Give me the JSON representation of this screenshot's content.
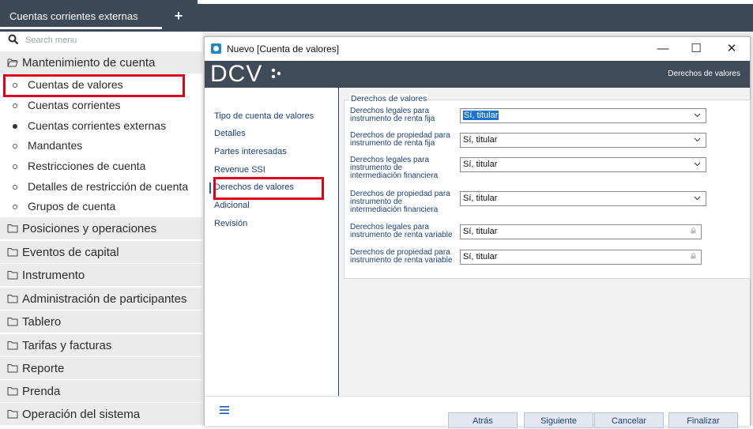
{
  "topbar": {
    "tab_label": "Cuentas corrientes externas",
    "add_icon": "plus-icon"
  },
  "sidebar": {
    "search_placeholder": "Search menu",
    "groups": [
      {
        "label": "Mantenimiento de cuenta",
        "expanded": true
      },
      {
        "label": "Posiciones y operaciones"
      },
      {
        "label": "Eventos de capital"
      },
      {
        "label": "Instrumento"
      },
      {
        "label": "Administración de participantes"
      },
      {
        "label": "Tablero"
      },
      {
        "label": "Tarifas y facturas"
      },
      {
        "label": "Reporte"
      },
      {
        "label": "Prenda"
      },
      {
        "label": "Operación del sistema"
      }
    ],
    "subitems": [
      {
        "label": "Cuentas de valores"
      },
      {
        "label": "Cuentas corrientes"
      },
      {
        "label": "Cuentas corrientes externas",
        "current": true
      },
      {
        "label": "Mandantes"
      },
      {
        "label": "Restricciones de cuenta"
      },
      {
        "label": "Detalles de restricción de cuenta"
      },
      {
        "label": "Grupos de cuenta"
      }
    ]
  },
  "dialog": {
    "title": "Nuevo [Cuenta de valores]",
    "logo": "DCV",
    "section_title": "Derechos de valores",
    "window_controls": {
      "minimize": "—",
      "maximize": "☐",
      "close": "✕"
    },
    "steps": [
      {
        "label": "Tipo de cuenta de valores"
      },
      {
        "label": "Detalles"
      },
      {
        "label": "Partes interesadas"
      },
      {
        "label": "Revenue SSI"
      },
      {
        "label": "Derechos de valores",
        "active": true
      },
      {
        "label": "Adicional"
      },
      {
        "label": "Revisión"
      }
    ],
    "group_legend": "Derechos de valores",
    "fields": [
      {
        "label_lines": [
          "Derechos legales para",
          "instrumento de renta fija"
        ],
        "value": "Sí, titular",
        "kind": "dropdown",
        "selected_text": true
      },
      {
        "label_lines": [
          "Derechos de propiedad para",
          "instrumento de renta fija"
        ],
        "value": "Sí, titular",
        "kind": "dropdown"
      },
      {
        "label_lines": [
          "Derechos legales para",
          "instrumento de",
          "intermediación financiera"
        ],
        "value": "Sí, titular",
        "kind": "dropdown"
      },
      {
        "label_lines": [
          "Derechos de propiedad para",
          "instrumento de",
          "intermediación financiera"
        ],
        "value": "Sí, titular",
        "kind": "dropdown"
      },
      {
        "label_lines": [
          "Derechos legales para",
          "instrumento de renta variable"
        ],
        "value": "Sí, titular",
        "kind": "readonly"
      },
      {
        "label_lines": [
          "Derechos de propiedad para",
          "instrumento de renta variable"
        ],
        "value": "Sí, titular",
        "kind": "readonly"
      }
    ],
    "footer": {
      "menu_icon": "hamburger-icon",
      "back_label": "Atrás",
      "next_label": "Siguiente",
      "cancel_label": "Cancelar",
      "finish_label": "Finalizar"
    }
  },
  "colors": {
    "header_bg": "#3f4b58",
    "link_blue": "#1d3f7a",
    "highlight_red": "#e0001a",
    "selection_blue": "#1a73d4"
  }
}
